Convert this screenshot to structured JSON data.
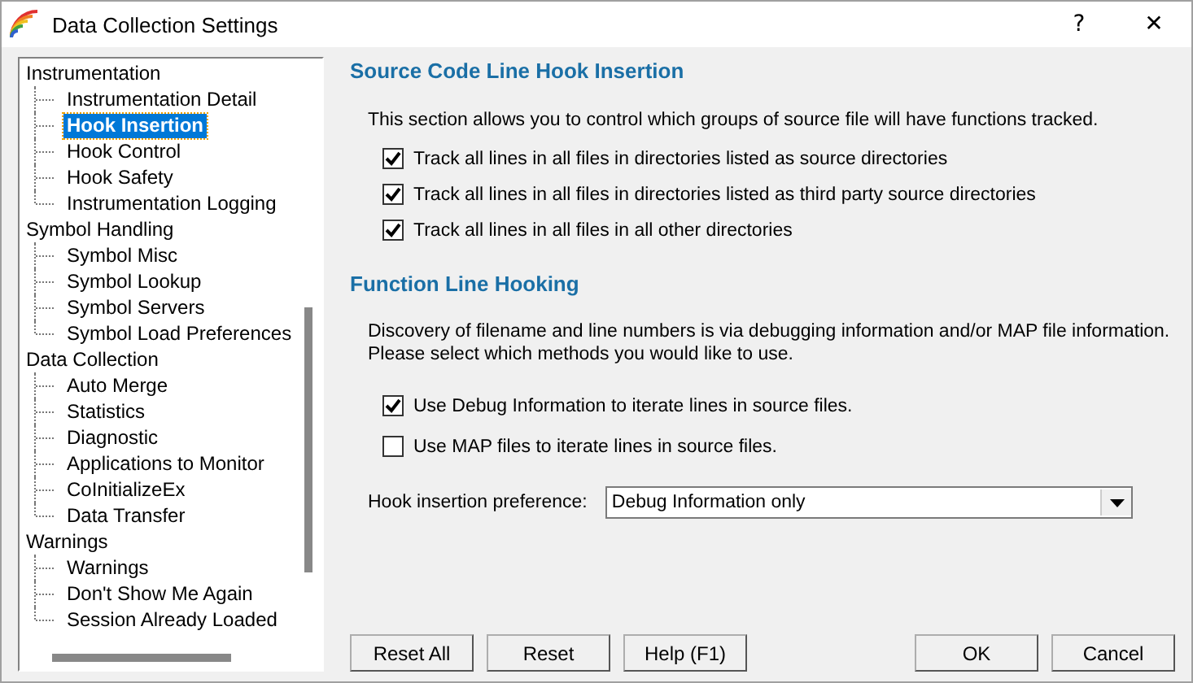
{
  "window": {
    "title": "Data Collection Settings",
    "help": "?",
    "close": "✕"
  },
  "tree": [
    {
      "label": "Instrumentation",
      "selected": false,
      "children": [
        {
          "label": "Instrumentation Detail",
          "selected": false
        },
        {
          "label": "Hook Insertion",
          "selected": true
        },
        {
          "label": "Hook Control",
          "selected": false
        },
        {
          "label": "Hook Safety",
          "selected": false
        },
        {
          "label": "Instrumentation Logging",
          "selected": false
        }
      ]
    },
    {
      "label": "Symbol Handling",
      "selected": false,
      "children": [
        {
          "label": "Symbol Misc",
          "selected": false
        },
        {
          "label": "Symbol Lookup",
          "selected": false
        },
        {
          "label": "Symbol Servers",
          "selected": false
        },
        {
          "label": "Symbol Load Preferences",
          "selected": false
        }
      ]
    },
    {
      "label": "Data Collection",
      "selected": false,
      "children": [
        {
          "label": "Auto Merge",
          "selected": false
        },
        {
          "label": "Statistics",
          "selected": false
        },
        {
          "label": "Diagnostic",
          "selected": false
        },
        {
          "label": "Applications to Monitor",
          "selected": false
        },
        {
          "label": "CoInitializeEx",
          "selected": false
        },
        {
          "label": "Data Transfer",
          "selected": false
        }
      ]
    },
    {
      "label": "Warnings",
      "selected": false,
      "children": [
        {
          "label": "Warnings",
          "selected": false
        },
        {
          "label": "Don't Show Me Again",
          "selected": false
        },
        {
          "label": "Session Already Loaded",
          "selected": false
        }
      ]
    }
  ],
  "sections": [
    {
      "heading": "Source Code Line Hook Insertion",
      "description": "This section allows you to control which groups of source file will have functions tracked.",
      "options": [
        {
          "label": "Track all lines in all files in directories listed as source directories",
          "checked": true
        },
        {
          "label": "Track all lines in all files in directories listed as third party source directories",
          "checked": true
        },
        {
          "label": "Track all lines in all files in all other directories",
          "checked": true
        }
      ]
    },
    {
      "heading": "Function Line Hooking",
      "description": "Discovery of filename and line numbers is via debugging information and/or MAP file information.\nPlease select which methods you would like to use.",
      "options": [
        {
          "label": "Use Debug Information to iterate lines in source files.",
          "checked": true
        },
        {
          "label": "Use MAP files to iterate lines in source files.",
          "checked": false
        }
      ],
      "preference": {
        "label": "Hook insertion preference:",
        "value": "Debug Information only"
      }
    }
  ],
  "buttons_left": [
    "Reset All",
    "Reset",
    "Help (F1)"
  ],
  "buttons_right": [
    "OK",
    "Cancel"
  ]
}
